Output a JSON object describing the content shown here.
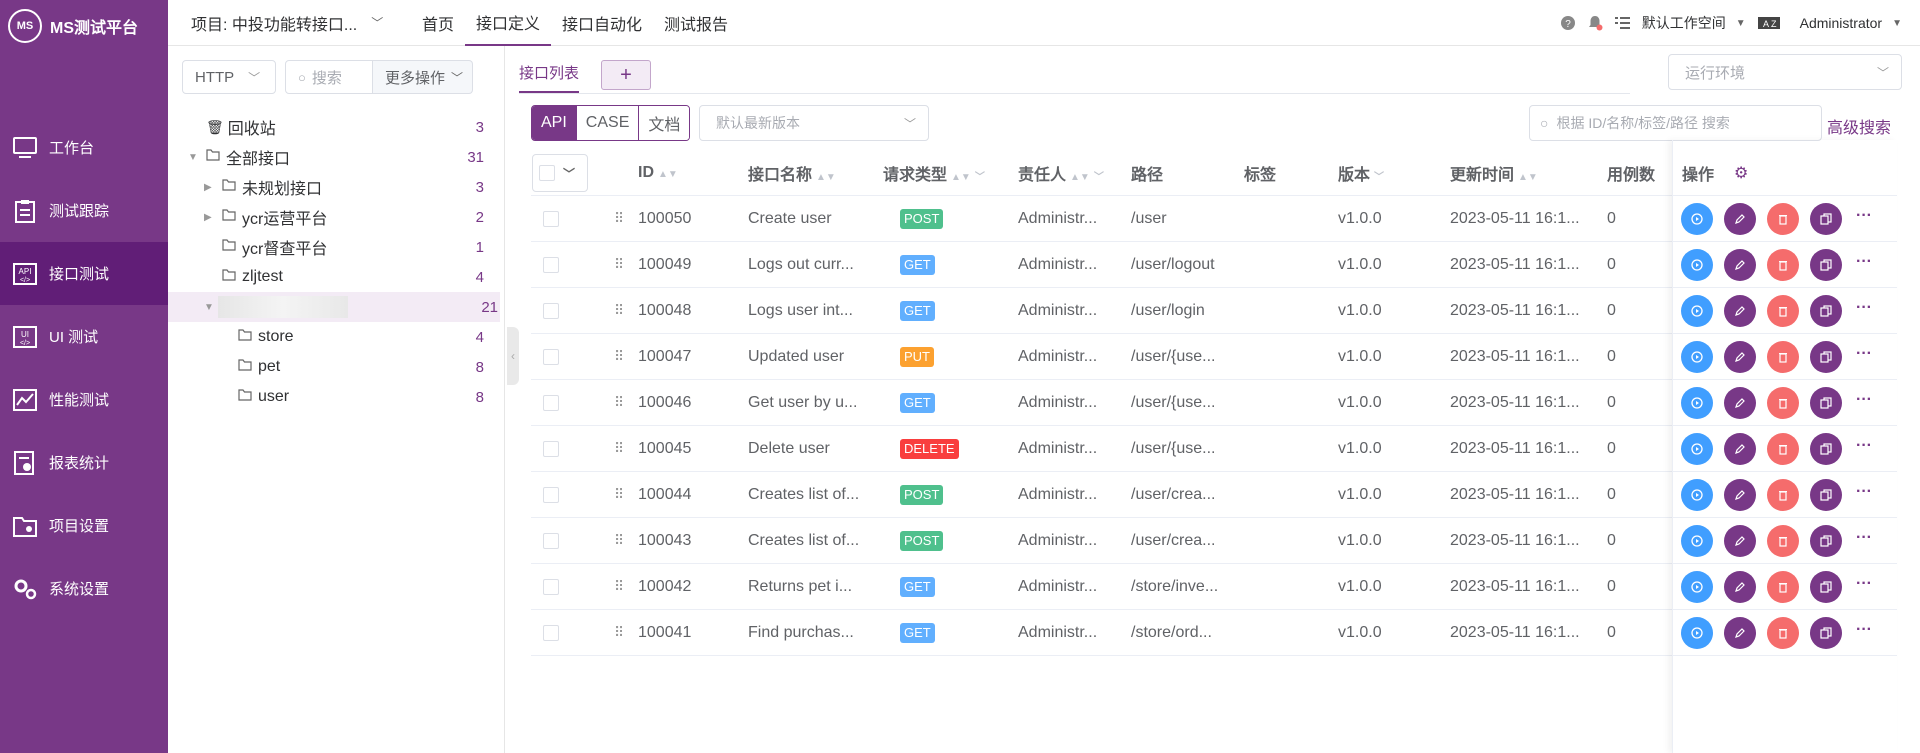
{
  "app": {
    "name": "MS测试平台",
    "logo_text": "MS"
  },
  "sidebar": {
    "items": [
      {
        "label": "工作台",
        "icon": "monitor-icon"
      },
      {
        "label": "测试跟踪",
        "icon": "clipboard-icon"
      },
      {
        "label": "接口测试",
        "icon": "api-icon",
        "active": true
      },
      {
        "label": "UI 测试",
        "icon": "ui-icon"
      },
      {
        "label": "性能测试",
        "icon": "chart-icon"
      },
      {
        "label": "报表统计",
        "icon": "report-icon"
      },
      {
        "label": "项目设置",
        "icon": "folder-settings-icon"
      },
      {
        "label": "系统设置",
        "icon": "gears-icon"
      }
    ]
  },
  "header": {
    "project": "项目: 中投功能转接口...",
    "tabs": [
      "首页",
      "接口定义",
      "接口自动化",
      "测试报告"
    ],
    "active_tab": 1,
    "workspace": "默认工作空间",
    "user": "Administrator"
  },
  "tree_panel": {
    "protocol": "HTTP",
    "search_placeholder": "搜索",
    "more_ops": "更多操作",
    "trash": {
      "label": "回收站",
      "count": "3"
    },
    "nodes": [
      {
        "label": "全部接口",
        "count": "31",
        "level": 0,
        "arrow": "▼"
      },
      {
        "label": "未规划接口",
        "count": "3",
        "level": 1,
        "arrow": "▶"
      },
      {
        "label": "ycr运营平台",
        "count": "2",
        "level": 1,
        "arrow": "▶"
      },
      {
        "label": "ycr督查平台",
        "count": "1",
        "level": 1,
        "arrow": ""
      },
      {
        "label": "zljtest",
        "count": "4",
        "level": 1,
        "arrow": ""
      },
      {
        "label": "",
        "count": "21",
        "level": 1,
        "arrow": "▼",
        "selected": true
      },
      {
        "label": "store",
        "count": "4",
        "level": 2,
        "arrow": ""
      },
      {
        "label": "pet",
        "count": "8",
        "level": 2,
        "arrow": ""
      },
      {
        "label": "user",
        "count": "8",
        "level": 2,
        "arrow": ""
      }
    ]
  },
  "main": {
    "tab_label": "接口列表",
    "add_tab": "+",
    "env_placeholder": "运行环境",
    "modes": [
      "API",
      "CASE",
      "文档"
    ],
    "version_placeholder": "默认最新版本",
    "search_placeholder": "根据 ID/名称/标签/路径 搜索",
    "advanced_search": "高级搜索",
    "columns": {
      "id": "ID",
      "name": "接口名称",
      "method": "请求类型",
      "owner": "责任人",
      "path": "路径",
      "tags": "标签",
      "version": "版本",
      "updated": "更新时间",
      "cases": "用例数",
      "ops": "操作"
    },
    "rows": [
      {
        "id": "100050",
        "name": "Create user",
        "method": "POST",
        "owner": "Administr...",
        "path": "/user",
        "version": "v1.0.0",
        "updated": "2023-05-11 16:1...",
        "cases": "0"
      },
      {
        "id": "100049",
        "name": "Logs out curr...",
        "method": "GET",
        "owner": "Administr...",
        "path": "/user/logout",
        "version": "v1.0.0",
        "updated": "2023-05-11 16:1...",
        "cases": "0"
      },
      {
        "id": "100048",
        "name": "Logs user int...",
        "method": "GET",
        "owner": "Administr...",
        "path": "/user/login",
        "version": "v1.0.0",
        "updated": "2023-05-11 16:1...",
        "cases": "0"
      },
      {
        "id": "100047",
        "name": "Updated user",
        "method": "PUT",
        "owner": "Administr...",
        "path": "/user/{use...",
        "version": "v1.0.0",
        "updated": "2023-05-11 16:1...",
        "cases": "0"
      },
      {
        "id": "100046",
        "name": "Get user by u...",
        "method": "GET",
        "owner": "Administr...",
        "path": "/user/{use...",
        "version": "v1.0.0",
        "updated": "2023-05-11 16:1...",
        "cases": "0"
      },
      {
        "id": "100045",
        "name": "Delete user",
        "method": "DELETE",
        "owner": "Administr...",
        "path": "/user/{use...",
        "version": "v1.0.0",
        "updated": "2023-05-11 16:1...",
        "cases": "0"
      },
      {
        "id": "100044",
        "name": "Creates list of...",
        "method": "POST",
        "owner": "Administr...",
        "path": "/user/crea...",
        "version": "v1.0.0",
        "updated": "2023-05-11 16:1...",
        "cases": "0"
      },
      {
        "id": "100043",
        "name": "Creates list of...",
        "method": "POST",
        "owner": "Administr...",
        "path": "/user/crea...",
        "version": "v1.0.0",
        "updated": "2023-05-11 16:1...",
        "cases": "0"
      },
      {
        "id": "100042",
        "name": "Returns pet i...",
        "method": "GET",
        "owner": "Administr...",
        "path": "/store/inve...",
        "version": "v1.0.0",
        "updated": "2023-05-11 16:1...",
        "cases": "0"
      },
      {
        "id": "100041",
        "name": "Find purchas...",
        "method": "GET",
        "owner": "Administr...",
        "path": "/store/ord...",
        "version": "v1.0.0",
        "updated": "2023-05-11 16:1...",
        "cases": "0"
      }
    ]
  },
  "colors": {
    "brand": "#783887",
    "POST": "#4fc08d",
    "GET": "#61affe",
    "PUT": "#fca130",
    "DELETE": "#f93e3e",
    "run": "#409eff",
    "edit": "#783887",
    "delete": "#f56c6c",
    "copy": "#783887"
  }
}
